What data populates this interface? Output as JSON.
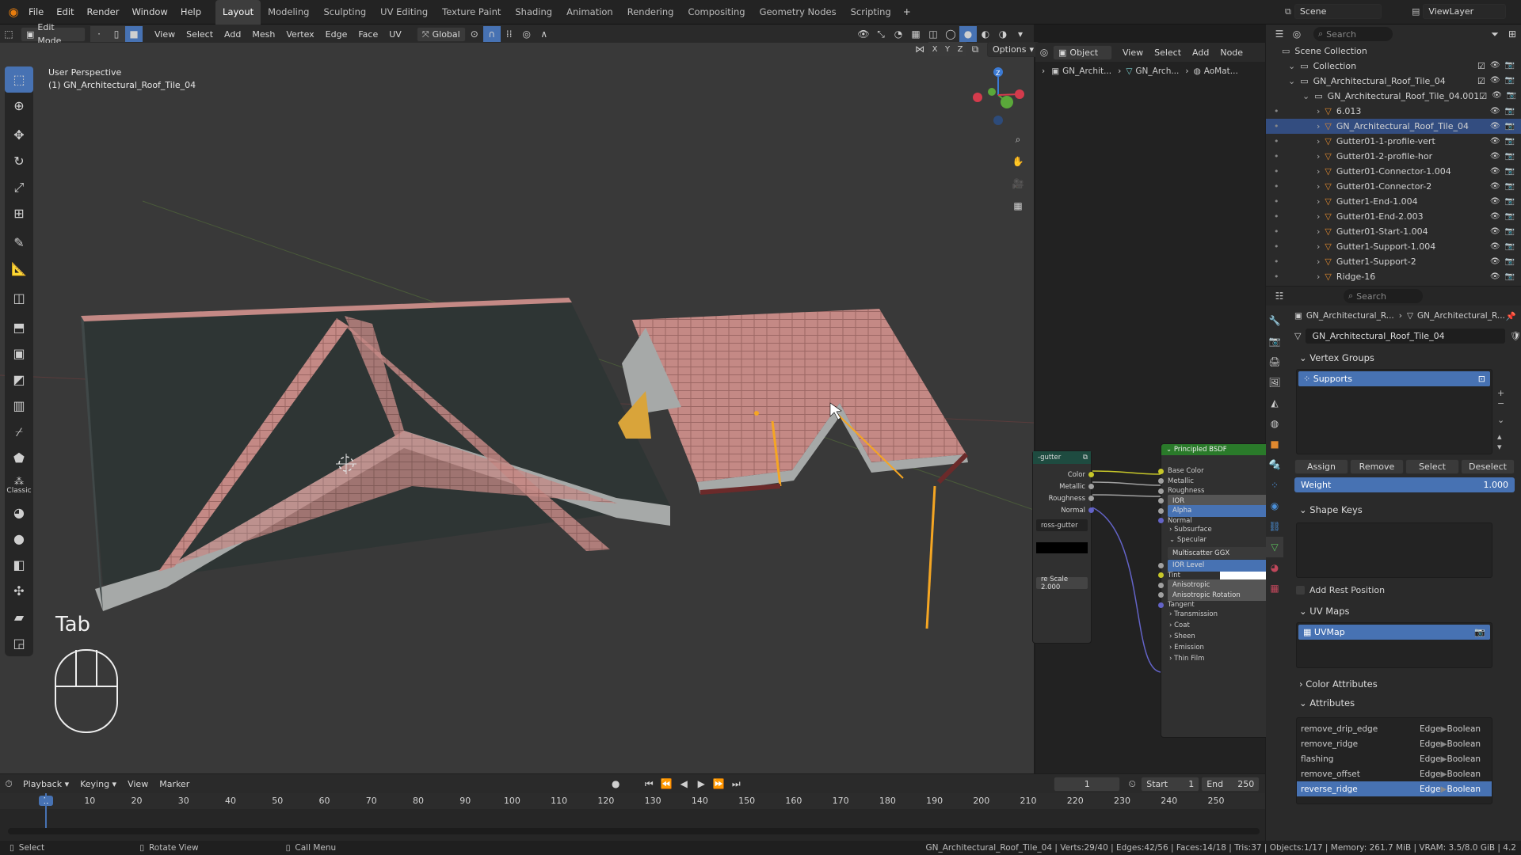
{
  "menubar": {
    "menus": [
      "File",
      "Edit",
      "Render",
      "Window",
      "Help"
    ],
    "workspaces": [
      "Layout",
      "Modeling",
      "Sculpting",
      "UV Editing",
      "Texture Paint",
      "Shading",
      "Animation",
      "Rendering",
      "Compositing",
      "Geometry Nodes",
      "Scripting"
    ],
    "active_workspace": "Layout",
    "scene_label": "Scene",
    "view_layer_label": "ViewLayer"
  },
  "viewport_header": {
    "mode": "Edit Mode",
    "menus": [
      "View",
      "Select",
      "Add",
      "Mesh",
      "Vertex",
      "Edge",
      "Face",
      "UV"
    ],
    "orientation": "Global",
    "options_label": "Options",
    "axes": [
      "X",
      "Y",
      "Z"
    ]
  },
  "viewport": {
    "perspective_label": "User Perspective",
    "object_label": "(1) GN_Architectural_Roof_Tile_04",
    "key_overlay": "Tab",
    "classic_label": "Classic"
  },
  "node_editor": {
    "object_mode": "Object",
    "menus": [
      "View",
      "Select",
      "Add",
      "Node"
    ],
    "breadcrumbs": [
      "GN_Archit...",
      "GN_Arch...",
      "AoMat..."
    ],
    "partial_node": {
      "title": "-gutter",
      "outputs": [
        "Color",
        "Metallic",
        "Roughness",
        "Normal"
      ],
      "field": "ross-gutter",
      "scale_field": "re Scale  2.000"
    },
    "bsdf": {
      "title": "Principled BSDF",
      "inputs": [
        "Base Color",
        "Metallic",
        "Roughness",
        "IOR",
        "Alpha",
        "Normal"
      ],
      "subs": [
        "Subsurface",
        "Specular"
      ],
      "distribution": "Multiscatter GGX",
      "spec_fields": [
        "IOR Level",
        "Tint",
        "Anisotropic",
        "Anisotropic Rotation"
      ],
      "tangent": "Tangent",
      "sections": [
        "Transmission",
        "Coat",
        "Sheen",
        "Emission",
        "Thin Film"
      ]
    }
  },
  "outliner": {
    "search_placeholder": "Search",
    "root": "Scene Collection",
    "items": [
      {
        "label": "Collection",
        "indent": 1
      },
      {
        "label": "GN_Architectural_Roof_Tile_04",
        "indent": 1
      },
      {
        "label": "GN_Architectural_Roof_Tile_04.001",
        "indent": 2
      },
      {
        "label": "6.013",
        "indent": 3
      },
      {
        "label": "GN_Architectural_Roof_Tile_04",
        "indent": 3,
        "selected": true
      },
      {
        "label": "Gutter01-1-profile-vert",
        "indent": 3
      },
      {
        "label": "Gutter01-2-profile-hor",
        "indent": 3
      },
      {
        "label": "Gutter01-Connector-1.004",
        "indent": 3
      },
      {
        "label": "Gutter01-Connector-2",
        "indent": 3
      },
      {
        "label": "Gutter1-End-1.004",
        "indent": 3
      },
      {
        "label": "Gutter01-End-2.003",
        "indent": 3
      },
      {
        "label": "Gutter01-Start-1.004",
        "indent": 3
      },
      {
        "label": "Gutter1-Support-1.004",
        "indent": 3
      },
      {
        "label": "Gutter1-Support-2",
        "indent": 3
      },
      {
        "label": "Ridge-16",
        "indent": 3
      }
    ]
  },
  "properties": {
    "search_placeholder": "Search",
    "breadcrumb": [
      "GN_Architectural_R...",
      "GN_Architectural_R..."
    ],
    "mesh_name": "GN_Architectural_Roof_Tile_04",
    "vertex_groups": {
      "title": "Vertex Groups",
      "items": [
        "Supports"
      ],
      "buttons": [
        "Assign",
        "Remove",
        "Select",
        "Deselect"
      ],
      "weight_label": "Weight",
      "weight_value": "1.000"
    },
    "shape_keys": {
      "title": "Shape Keys",
      "add_rest": "Add Rest Position"
    },
    "uv_maps": {
      "title": "UV Maps",
      "items": [
        "UVMap"
      ]
    },
    "color_attributes": {
      "title": "Color Attributes"
    },
    "attributes": {
      "title": "Attributes",
      "items": [
        {
          "name": "remove_drip_edge",
          "domain": "Edge",
          "type": "Boolean"
        },
        {
          "name": "remove_ridge",
          "domain": "Edge",
          "type": "Boolean"
        },
        {
          "name": "flashing",
          "domain": "Edge",
          "type": "Boolean"
        },
        {
          "name": "remove_offset",
          "domain": "Edge",
          "type": "Boolean"
        },
        {
          "name": "reverse_ridge",
          "domain": "Edge",
          "type": "Boolean",
          "selected": true
        }
      ]
    }
  },
  "timeline": {
    "menus": [
      "Playback",
      "Keying",
      "View",
      "Marker"
    ],
    "current_frame": "1",
    "start_label": "Start",
    "start_value": "1",
    "end_label": "End",
    "end_value": "250",
    "ticks": [
      "1",
      "10",
      "20",
      "30",
      "40",
      "50",
      "60",
      "70",
      "80",
      "90",
      "100",
      "110",
      "120",
      "130",
      "140",
      "150",
      "160",
      "170",
      "180",
      "190",
      "200",
      "210",
      "220",
      "230",
      "240",
      "250"
    ]
  },
  "statusbar": {
    "select": "Select",
    "rotate": "Rotate View",
    "call_menu": "Call Menu",
    "stats": "GN_Architectural_Roof_Tile_04 | Verts:29/40 | Edges:42/56 | Faces:14/18 | Tris:37 | Objects:1/17 | Memory: 261.7 MiB | VRAM: 3.5/8.0 GiB | 4.2"
  },
  "colors": {
    "accent": "#4772b3",
    "selection": "#f5a623",
    "roof": "#c48985",
    "bsdf_header": "#2a7a2a"
  }
}
